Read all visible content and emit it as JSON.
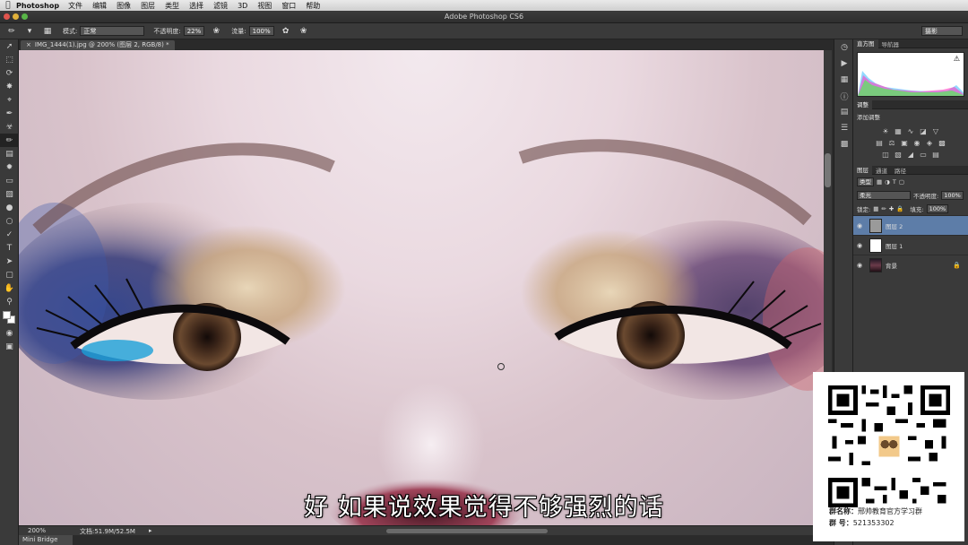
{
  "menubar": {
    "app": "Photoshop",
    "items": [
      "文件",
      "编辑",
      "图像",
      "图层",
      "类型",
      "选择",
      "滤镜",
      "3D",
      "视图",
      "窗口",
      "帮助"
    ]
  },
  "window": {
    "title": "Adobe Photoshop CS6"
  },
  "options": {
    "mode_label": "模式:",
    "mode_value": "正常",
    "opacity_label": "不透明度:",
    "opacity_value": "22%",
    "flow_label": "流量:",
    "flow_value": "100%",
    "workspace": "摄影"
  },
  "document": {
    "tab_title": "IMG_1444(1).jpg @ 200% (图层 2, RGB/8) *",
    "subtitle": "好  如果说效果觉得不够强烈的话"
  },
  "status": {
    "zoom": "200%",
    "doc_size": "文档:51.9M/52.5M",
    "mini_bridge": "Mini Bridge"
  },
  "panels": {
    "histogram_tabs": [
      "直方图",
      "导航器"
    ],
    "adjustments_tab": "调整",
    "adjustments_title": "添加调整",
    "layers_tabs": [
      "图层",
      "通道",
      "路径"
    ],
    "filter_kind": "类型",
    "blend_mode": "柔光",
    "opacity_label": "不透明度:",
    "opacity_value": "100%",
    "lock_label": "锁定:",
    "fill_label": "填充:",
    "fill_value": "100%",
    "layers": [
      {
        "name": "图层 2",
        "selected": true
      },
      {
        "name": "图层 1",
        "selected": false
      },
      {
        "name": "背景",
        "selected": false
      }
    ]
  },
  "promo": {
    "group_name_label": "群名称：",
    "group_name": "邢帅教育官方学习群",
    "group_number_label": "群   号：",
    "group_number": "521353302"
  },
  "colors": {
    "selected_layer": "#5d7da8",
    "panel_bg": "#3a3a3a"
  }
}
